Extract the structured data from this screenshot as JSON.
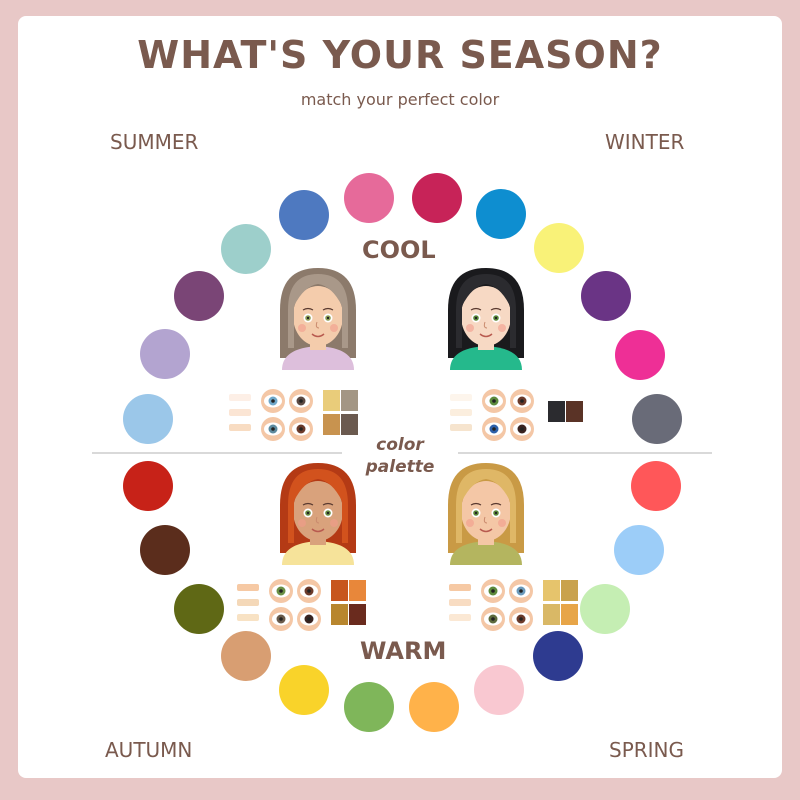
{
  "title": "WHAT'S YOUR SEASON?",
  "subtitle": "match your perfect color",
  "seasons": {
    "summer": "SUMMER",
    "winter": "WINTER",
    "autumn": "AUTUMN",
    "spring": "SPRING"
  },
  "axis": {
    "cool": "COOL",
    "warm": "WARM"
  },
  "center_label": {
    "line1": "color",
    "line2": "palette"
  },
  "swatches": {
    "summer": [
      "#9bc7e9",
      "#b3a4d0",
      "#7a4576",
      "#9dcfcb",
      "#4e79c0",
      "#e66a9a"
    ],
    "winter": [
      "#c72358",
      "#0e8ed0",
      "#f9f278",
      "#6a3485",
      "#ee2f96",
      "#696b78"
    ],
    "autumn": [
      "#c72218",
      "#5b2d1c",
      "#5f6815",
      "#d89e72",
      "#f9d32a",
      "#7fb65a"
    ],
    "spring": [
      "#ffb24a",
      "#f9c8d1",
      "#2e3b90",
      "#c5eeb3",
      "#9ccdf8",
      "#ff5759"
    ]
  },
  "portraits": {
    "summer": {
      "hair": "#a99889",
      "hair_dark": "#8c7a6b",
      "skin": "#f4ccac",
      "shirt": "#ddbfdc",
      "eyes": [
        "#8ea05a",
        "#7b8b85"
      ]
    },
    "winter": {
      "hair": "#2b2b2f",
      "hair_dark": "#1a1a1d",
      "skin": "#f7d9c4",
      "shirt": "#25b98c",
      "eyes": [
        "#5d8a3c",
        "#6b3a2a"
      ]
    },
    "autumn": {
      "hair": "#d2521d",
      "hair_dark": "#b43a15",
      "skin": "#d9a27c",
      "shirt": "#f6e39a",
      "eyes": [
        "#6a8f45",
        "#6b3a2a"
      ]
    },
    "spring": {
      "hair": "#dfb766",
      "hair_dark": "#c99a45",
      "skin": "#f4c7a6",
      "shirt": "#b4b55f",
      "eyes": [
        "#5d8a3c",
        "#4a6fa0"
      ]
    }
  },
  "palettes": {
    "summer": {
      "skin": [
        "#fdefe6",
        "#fbe5d4",
        "#f8dcc2"
      ],
      "eyes": [
        "#6fa7c9",
        "#5c4a43",
        "#5d8a9e",
        "#6b3a2a"
      ],
      "hair": [
        "#e9cc7a",
        "#a39684",
        "#c8934f",
        "#6b5a4f"
      ]
    },
    "winter": {
      "skin": [
        "#fdf5ec",
        "#fbeede",
        "#f6e4ce"
      ],
      "eyes": [
        "#5d8a3c",
        "#6b3a2a",
        "#2d5fa8",
        "#3a2320"
      ],
      "hair": [
        "#2b2b2f",
        "#5a3326"
      ]
    },
    "autumn": {
      "skin": [
        "#f6c9a4",
        "#f4d8b8",
        "#f8e2c4"
      ],
      "eyes": [
        "#6a8f45",
        "#6b3a2a",
        "#6a5a4a",
        "#3a2320"
      ],
      "hair": [
        "#c7561e",
        "#e8873a",
        "#b8862e",
        "#6a2b1e"
      ]
    },
    "spring": {
      "skin": [
        "#f6c9a4",
        "#f8dcc2",
        "#fbe8d4"
      ],
      "eyes": [
        "#5d8a3c",
        "#6b9abb",
        "#5d6a3c",
        "#6b3a2a"
      ],
      "hair": [
        "#e6c46c",
        "#c9a24d",
        "#d9b866",
        "#e7a548"
      ]
    }
  }
}
